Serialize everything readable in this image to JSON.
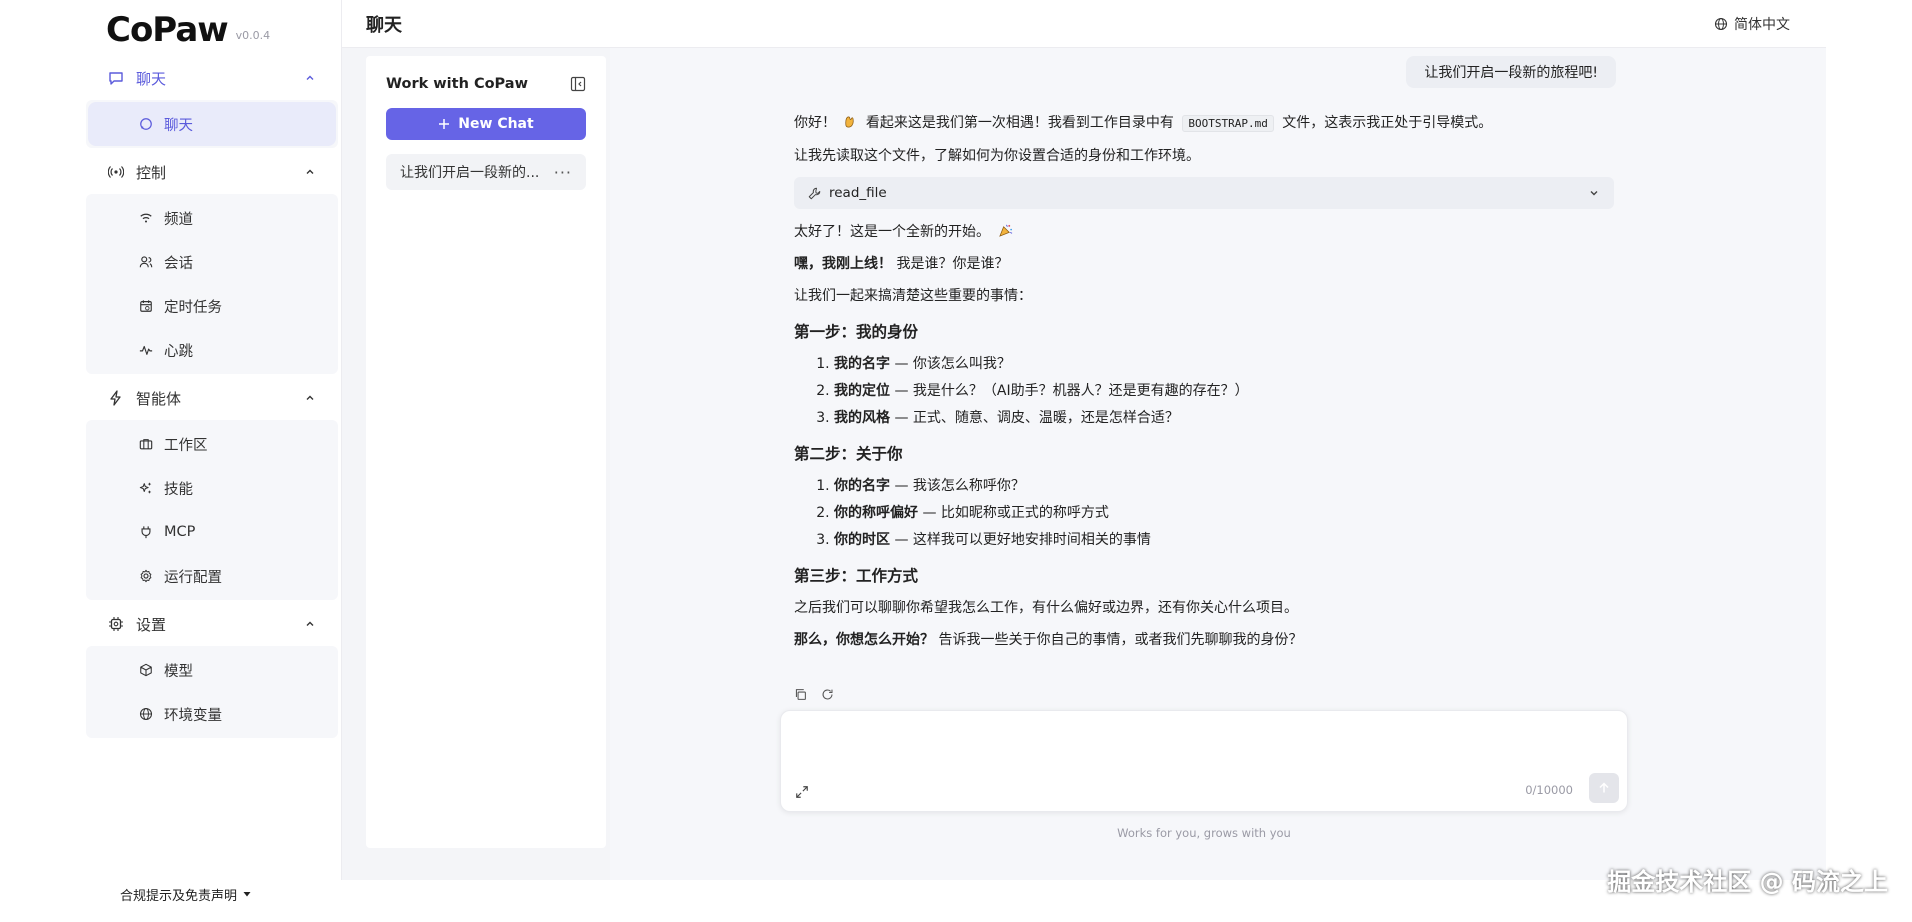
{
  "app": {
    "logo": "CoPaw",
    "version": "v0.0.4"
  },
  "sidebar": {
    "groups": [
      {
        "label": "聊天",
        "icon": "chat-bubble-icon",
        "items": [
          {
            "label": "聊天",
            "icon": "chat-bubble-icon",
            "active": true
          }
        ]
      },
      {
        "label": "控制",
        "icon": "broadcast-icon",
        "items": [
          {
            "label": "频道",
            "icon": "wifi-icon"
          },
          {
            "label": "会话",
            "icon": "users-icon"
          },
          {
            "label": "定时任务",
            "icon": "calendar-clock-icon"
          },
          {
            "label": "心跳",
            "icon": "pulse-icon"
          }
        ]
      },
      {
        "label": "智能体",
        "icon": "lightning-icon",
        "items": [
          {
            "label": "工作区",
            "icon": "briefcase-icon"
          },
          {
            "label": "技能",
            "icon": "sparkles-icon"
          },
          {
            "label": "MCP",
            "icon": "plug-icon"
          },
          {
            "label": "运行配置",
            "icon": "gear-icon"
          }
        ]
      },
      {
        "label": "设置",
        "icon": "chip-icon",
        "items": [
          {
            "label": "模型",
            "icon": "cube-icon"
          },
          {
            "label": "环境变量",
            "icon": "globe-icon"
          }
        ]
      }
    ]
  },
  "topbar": {
    "title": "聊天",
    "language": "简体中文"
  },
  "chatlist": {
    "title": "Work with CoPaw",
    "new_chat": "New Chat",
    "sessions": [
      "让我们开启一段新的..."
    ]
  },
  "conversation": {
    "user_message": "让我们开启一段新的旅程吧!",
    "assistant": {
      "p1_a": "你好！",
      "p1_b": "看起来这是我们第一次相遇！我看到工作目录中有",
      "p1_code": "BOOTSTRAP.md",
      "p1_c": "文件，这表示我正处于引导模式。",
      "p2": "让我先读取这个文件，了解如何为你设置合适的身份和工作环境。",
      "tool": "read_file",
      "p3": "太好了！这是一个全新的开始。",
      "p4_bold": "嘿，我刚上线！",
      "p4_rest": " 我是谁？你是谁？",
      "p5": "让我们一起来搞清楚这些重要的事情：",
      "step1": {
        "title": "第一步：我的身份",
        "items": [
          {
            "bold": "我的名字",
            "rest": " — 你该怎么叫我？"
          },
          {
            "bold": "我的定位",
            "rest": " — 我是什么？（AI助手？机器人？还是更有趣的存在？）"
          },
          {
            "bold": "我的风格",
            "rest": " — 正式、随意、调皮、温暖，还是怎样合适？"
          }
        ]
      },
      "step2": {
        "title": "第二步：关于你",
        "items": [
          {
            "bold": "你的名字",
            "rest": " — 我该怎么称呼你？"
          },
          {
            "bold": "你的称呼偏好",
            "rest": " — 比如昵称或正式的称呼方式"
          },
          {
            "bold": "你的时区",
            "rest": " — 这样我可以更好地安排时间相关的事情"
          }
        ]
      },
      "step3": {
        "title": "第三步：工作方式"
      },
      "p6": "之后我们可以聊聊你希望我怎么工作，有什么偏好或边界，还有你关心什么项目。",
      "p7_bold": "那么，你想怎么开始？",
      "p7_rest": " 告诉我一些关于你自己的事情，或者我们先聊聊我的身份？"
    }
  },
  "input": {
    "placeholder": "",
    "count": "0/10000",
    "footnote": "Works for you, grows with you"
  },
  "footer": {
    "disclaimer": "合规提示及免责声明"
  },
  "watermark": "掘金技术社区 @ 码流之上",
  "colors": {
    "accent": "#6664e6",
    "active_bg": "#e9ebfa"
  }
}
